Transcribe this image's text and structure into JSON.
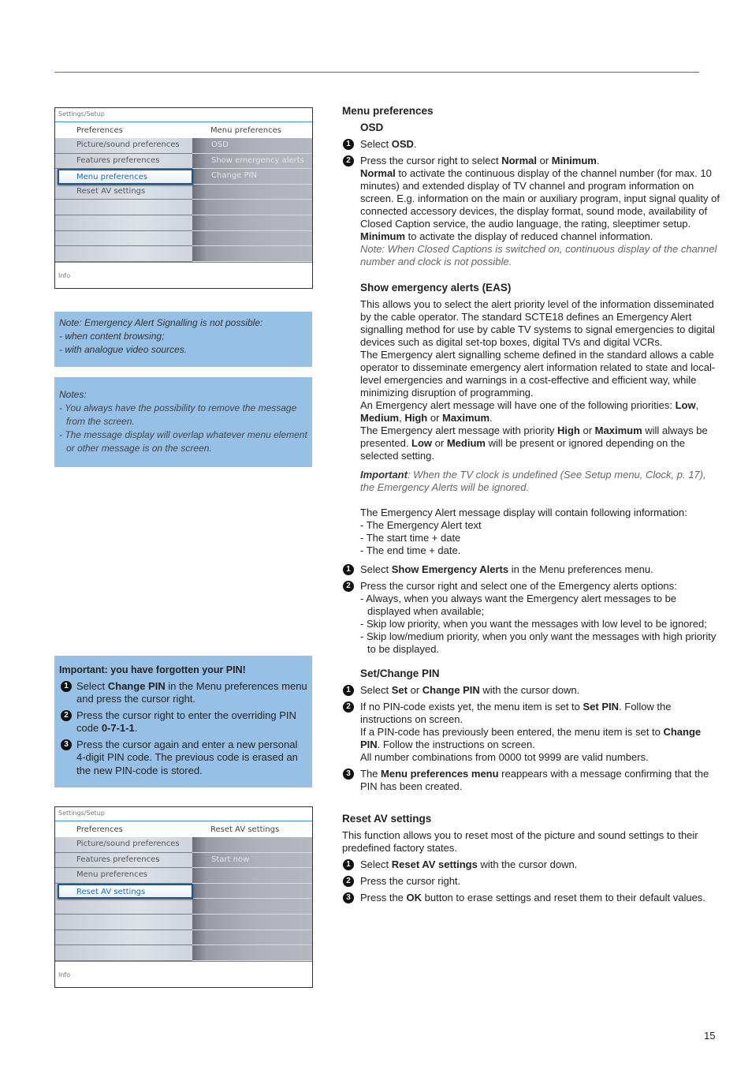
{
  "accent_color": "#1a86c0",
  "note_bg_color": "#96c0e6",
  "page_number": "15",
  "tv_menu_1": {
    "breadcrumb": "Settings/Setup",
    "left_header": "Preferences",
    "right_header": "Menu preferences",
    "left_items": [
      "Picture/sound preferences",
      "Features preferences",
      "Menu preferences",
      "Reset AV settings",
      "",
      "",
      "",
      ""
    ],
    "selected_index": 2,
    "right_items": [
      "OSD",
      "Show emergency alerts",
      "Change PIN",
      "",
      "",
      "",
      "",
      ""
    ],
    "info": "Info"
  },
  "tv_menu_2": {
    "breadcrumb": "Settings/Setup",
    "left_header": "Preferences",
    "right_header": "Reset AV settings",
    "left_items": [
      "Picture/sound preferences",
      "Features preferences",
      "Menu preferences",
      "Reset AV settings",
      "",
      "",
      "",
      ""
    ],
    "selected_index": 3,
    "right_items": [
      "",
      "Start now",
      "",
      "",
      "",
      "",
      "",
      ""
    ],
    "info": "Info"
  },
  "note_eas": {
    "title": "Note: Emergency Alert Signalling is not possible:",
    "lines": [
      "- when content browsing;",
      "- with analogue video sources."
    ]
  },
  "note_message": {
    "title": "Notes:",
    "lines": [
      "- You always have the possibility to remove the message from the screen.",
      "- The message display will overlap whatever menu element or other message is on the screen."
    ]
  },
  "pin_box": {
    "title": "Important: you have forgotten your PIN!",
    "steps": [
      {
        "n": "1",
        "html": "Select <b>Change PIN</b> in the Menu preferences menu and press the cursor right."
      },
      {
        "n": "2",
        "html": "Press the cursor right to enter the overriding PIN code <b>0-7-1-1</b>."
      },
      {
        "n": "3",
        "html": "Press the cursor again and enter a new personal 4-digit PIN code. The previous code is erased an the new PIN-code is stored."
      }
    ]
  },
  "main": {
    "heading": "Menu preferences",
    "osd": {
      "title": "OSD",
      "steps": [
        {
          "n": "1",
          "html": "Select <b>OSD</b>."
        },
        {
          "n": "2",
          "html": "Press the cursor right to select <b>Normal</b> or <b>Minimum</b>.<br><b>Normal</b> to activate the continuous display of the channel number (for max. 10 minutes) and extended display of TV channel and program information on screen. E.g. information on the main or auxiliary program, input signal quality of connected accessory devices, the display format, sound mode, availability of Closed Caption service, the audio language, the rating, sleeptimer setup.<br><b>Minimum</b> to activate the display of reduced channel information.<br><span class=\"it\">Note: When Closed Captions is switched on, continuous display of the channel number and clock is not possible.</span>"
        }
      ]
    },
    "eas": {
      "title": "Show emergency alerts (EAS)",
      "body_html": "This allows you to select the alert priority level of the information disseminated by the cable operator. The standard SCTE18 defines an Emergency Alert signalling method for use by cable TV systems to signal emergencies to digital devices such as digital set-top boxes, digital TVs and digital VCRs.<br>The Emergency alert signalling scheme defined in the standard allows a cable operator to disseminate emergency alert information related to state and local-level emergencies and warnings in a cost-effective and efficient way, while minimizing disruption of programming.<br>An Emergency alert message will have one of the following priorities: <b>Low</b>, <b>Medium</b>, <b>High</b> or <b>Maximum</b>.<br>The Emergency alert message with priority <b>High</b> or <b>Maximum</b> will always be presented. <b>Low</b> or <b>Medium</b> will be present or ignored depending on the selected setting.",
      "important_label": "Important",
      "important_text": ": When the TV clock is undefined (See Setup menu, Clock, p. 17), the Emergency Alerts will be ignored.",
      "display_intro": "The Emergency Alert message display will contain following information:",
      "display_items": [
        "- The Emergency Alert text",
        "- The start time + date",
        "- The end time + date."
      ],
      "steps": [
        {
          "n": "1",
          "html": "Select <b>Show Emergency Alerts</b> in the Menu preferences menu."
        },
        {
          "n": "2",
          "html": "Press the cursor right and select one of the Emergency alerts options:<div class=\"dash\">- Always, when you always want the Emergency alert messages to be displayed when available;</div><div class=\"dash\">- Skip low priority, when you want the messages with low level to be ignored;</div><div class=\"dash\">- Skip low/medium priority, when you only want the messages with high priority to be displayed.</div>"
        }
      ]
    },
    "pin": {
      "title": "Set/Change PIN",
      "steps": [
        {
          "n": "1",
          "html": "Select <b>Set</b> or <b>Change PIN</b> with the cursor down."
        },
        {
          "n": "2",
          "html": "If no PIN-code exists yet, the menu item is set to <b>Set PIN</b>. Follow the instructions on screen.<br>If a PIN-code has previously been entered, the menu item is set to <b>Change PIN</b>. Follow the instructions on screen.<br>All number combinations from 0000 tot 9999 are valid numbers."
        },
        {
          "n": "3",
          "html": "The <b>Menu preferences menu</b> reappears with a message confirming that the PIN has been created."
        }
      ]
    },
    "reset": {
      "title": "Reset AV settings",
      "intro": "This function allows you to reset most of the picture and sound settings to their predefined factory states.",
      "steps": [
        {
          "n": "1",
          "html": "Select <b>Reset AV settings</b> with the cursor down."
        },
        {
          "n": "2",
          "html": "Press the cursor right."
        },
        {
          "n": "3",
          "html": "Press the <b>OK</b> button to erase settings and reset them to their default values."
        }
      ]
    }
  }
}
